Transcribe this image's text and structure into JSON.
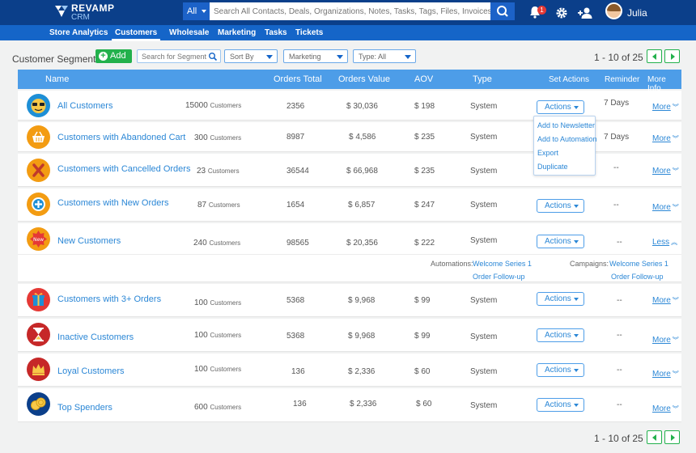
{
  "app": {
    "logo_name": "REVAMP",
    "logo_sub": "CRM",
    "search_scope": "All",
    "search_placeholder": "Search All Contacts, Deals, Organizations, Notes, Tasks, Tags, Files, Invoices and Tickets",
    "notification_count": "1",
    "user_name": "Julia",
    "accent": "#1565c8",
    "header_bg": "#0b3f8a"
  },
  "nav": {
    "items": [
      "Store Analytics",
      "Customers",
      "Wholesale",
      "Marketing",
      "Tasks",
      "Tickets"
    ],
    "active": "Customers"
  },
  "toolbar": {
    "title": "Customer Segments",
    "add_label": "Add",
    "search_placeholder": "Search for Segments",
    "sort_label": "Sort By",
    "filter_label": "Marketing",
    "type_label": "Type: All",
    "pager_range": "1 - 10",
    "pager_of": "of 25"
  },
  "table": {
    "headers": {
      "name": "Name",
      "orders_total": "Orders Total",
      "orders_value": "Orders Value",
      "aov": "AOV",
      "type": "Type",
      "set_actions": "Set Actions",
      "reminder": "Reminder",
      "more_info": "More Info"
    },
    "unit_label": "Customers",
    "actions_label": "Actions",
    "more_label": "More",
    "less_label": "Less",
    "rows": [
      {
        "name": "All Customers",
        "count": "15000",
        "orders_total": "2356",
        "orders_value": "$ 30,036",
        "aov": "$ 198",
        "type": "System",
        "reminder": "7 Days",
        "icon": "sunglasses-icon",
        "icon_color": "#1e8fd6"
      },
      {
        "name": "Customers with Abandoned Cart",
        "count": "300",
        "orders_total": "8987",
        "orders_value": "$ 4,586",
        "aov": "$ 235",
        "type": "System",
        "reminder": "7 Days",
        "icon": "basket-icon",
        "icon_color": "#f39c12"
      },
      {
        "name": "Customers with Cancelled Orders",
        "count": "23",
        "orders_total": "36544",
        "orders_value": "$ 66,968",
        "aov": "$ 235",
        "type": "System",
        "reminder": "--",
        "icon": "cancel-x-icon",
        "icon_color": "#f39c12"
      },
      {
        "name": "Customers with New Orders",
        "count": "87",
        "orders_total": "1654",
        "orders_value": "$ 6,857",
        "aov": "$ 247",
        "type": "System",
        "reminder": "--",
        "icon": "new-order-icon",
        "icon_color": "#f39c12"
      },
      {
        "name": "New Customers",
        "count": "240",
        "orders_total": "98565",
        "orders_value": "$ 20,356",
        "aov": "$ 222",
        "type": "System",
        "reminder": "--",
        "icon": "new-badge-icon",
        "icon_color": "#f39c12"
      },
      {
        "name": "Customers with 3+ Orders",
        "count": "100",
        "orders_total": "5368",
        "orders_value": "$ 9,968",
        "aov": "$ 99",
        "type": "System",
        "reminder": "--",
        "icon": "gift-icon",
        "icon_color": "#e53935"
      },
      {
        "name": "Inactive Customers",
        "count": "100",
        "orders_total": "5368",
        "orders_value": "$ 9,968",
        "aov": "$ 99",
        "type": "System",
        "reminder": "--",
        "icon": "hourglass-icon",
        "icon_color": "#c62828"
      },
      {
        "name": "Loyal Customers",
        "count": "100",
        "orders_total": "136",
        "orders_value": "$ 2,336",
        "aov": "$ 60",
        "type": "System",
        "reminder": "--",
        "icon": "crown-icon",
        "icon_color": "#c62828"
      },
      {
        "name": "Top Spenders",
        "count": "600",
        "orders_total": "136",
        "orders_value": "$ 2,336",
        "aov": "$ 60",
        "type": "System",
        "reminder": "--",
        "icon": "coins-icon",
        "icon_color": "#0b3f8a"
      }
    ],
    "expanded": {
      "automations_label": "Automations:",
      "automations": [
        "Welcome Series 1",
        "Order Follow-up"
      ],
      "campaigns_label": "Campaigns:",
      "campaigns": [
        "Welcome Series 1",
        "Order Follow-up"
      ]
    }
  },
  "actions_menu": {
    "items": [
      "Add to Newsletter",
      "Add to Automation",
      "Export",
      "Duplicate"
    ]
  }
}
